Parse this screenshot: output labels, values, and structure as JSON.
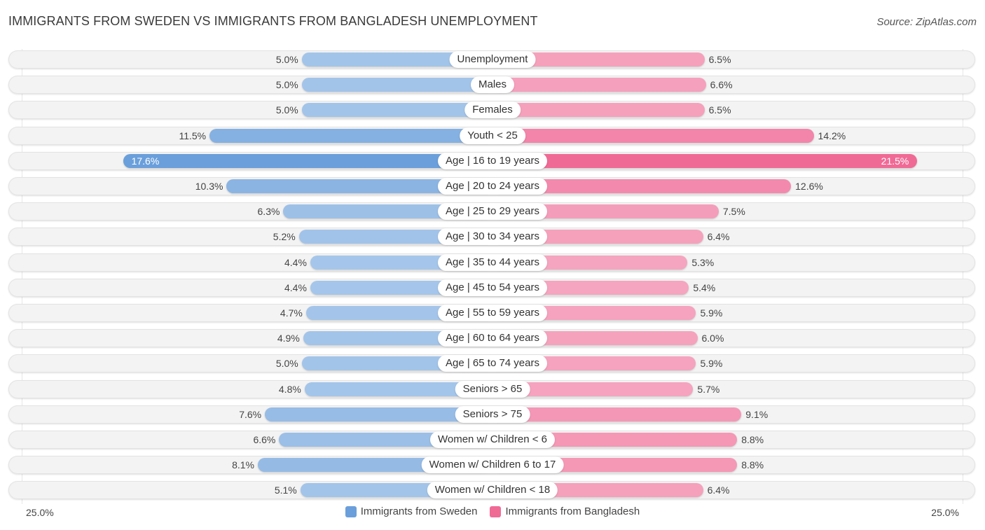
{
  "title": "IMMIGRANTS FROM SWEDEN VS IMMIGRANTS FROM BANGLADESH UNEMPLOYMENT",
  "source": "Source: ZipAtlas.com",
  "colors": {
    "sweden": "#a7c7ea",
    "sweden_strong": "#6a9fdb",
    "bangladesh": "#f5a6c0",
    "bangladesh_strong": "#f06a96",
    "legend_sweden": "#6a9fdb",
    "legend_bangladesh": "#f06a96"
  },
  "axis": {
    "left_label": "25.0%",
    "right_label": "25.0%"
  },
  "legend": [
    {
      "label": "Immigrants from Sweden",
      "key": "sweden"
    },
    {
      "label": "Immigrants from Bangladesh",
      "key": "bangladesh"
    }
  ],
  "chart_data": {
    "type": "bar",
    "orientation": "diverging-horizontal",
    "title": "IMMIGRANTS FROM SWEDEN VS IMMIGRANTS FROM BANGLADESH UNEMPLOYMENT",
    "xlabel": "",
    "ylabel": "",
    "xlim": [
      0,
      25
    ],
    "unit": "%",
    "legend_position": "bottom-center",
    "categories": [
      "Unemployment",
      "Males",
      "Females",
      "Youth < 25",
      "Age | 16 to 19 years",
      "Age | 20 to 24 years",
      "Age | 25 to 29 years",
      "Age | 30 to 34 years",
      "Age | 35 to 44 years",
      "Age | 45 to 54 years",
      "Age | 55 to 59 years",
      "Age | 60 to 64 years",
      "Age | 65 to 74 years",
      "Seniors > 65",
      "Seniors > 75",
      "Women w/ Children < 6",
      "Women w/ Children 6 to 17",
      "Women w/ Children < 18"
    ],
    "series": [
      {
        "name": "Immigrants from Sweden",
        "values": [
          5.0,
          5.0,
          5.0,
          11.5,
          17.6,
          10.3,
          6.3,
          5.2,
          4.4,
          4.4,
          4.7,
          4.9,
          5.0,
          4.8,
          7.6,
          6.6,
          8.1,
          5.1
        ]
      },
      {
        "name": "Immigrants from Bangladesh",
        "values": [
          6.5,
          6.6,
          6.5,
          14.2,
          21.5,
          12.6,
          7.5,
          6.4,
          5.3,
          5.4,
          5.9,
          6.0,
          5.9,
          5.7,
          9.1,
          8.8,
          8.8,
          6.4
        ]
      }
    ],
    "value_labels_sweden": [
      "5.0%",
      "5.0%",
      "5.0%",
      "11.5%",
      "17.6%",
      "10.3%",
      "6.3%",
      "5.2%",
      "4.4%",
      "4.4%",
      "4.7%",
      "4.9%",
      "5.0%",
      "4.8%",
      "7.6%",
      "6.6%",
      "8.1%",
      "5.1%"
    ],
    "value_labels_bangladesh": [
      "6.5%",
      "6.6%",
      "6.5%",
      "14.2%",
      "21.5%",
      "12.6%",
      "7.5%",
      "6.4%",
      "5.3%",
      "5.4%",
      "5.9%",
      "6.0%",
      "5.9%",
      "5.7%",
      "9.1%",
      "8.8%",
      "8.8%",
      "6.4%"
    ]
  }
}
